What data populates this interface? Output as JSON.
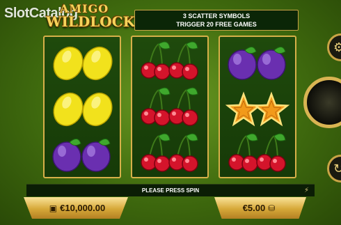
{
  "watermark": "SlotCatalog",
  "logo": {
    "line1": "AMIGO",
    "line2": "WILDLOCK",
    "small": ".com"
  },
  "info_banner": {
    "line1": "3 SCATTER SYMBOLS",
    "line2": "TRIGGER 20 FREE GAMES"
  },
  "reels": [
    [
      "lemon-pair",
      "lemon-pair",
      "plum-pair"
    ],
    [
      "cherry-pair",
      "cherry-pair",
      "cherry-pair"
    ],
    [
      "plum-pair",
      "star-pair",
      "cherry-pair"
    ]
  ],
  "status_text": "PLEASE PRESS SPIN",
  "balance": "€10,000.00",
  "bet": "€5.00",
  "icons": {
    "gear": "gear-icon",
    "spin": "spin-icon",
    "autoplay": "autoplay-icon",
    "wallet": "wallet-icon",
    "coins": "coin-stack-icon",
    "bolt": "lightning-icon"
  }
}
